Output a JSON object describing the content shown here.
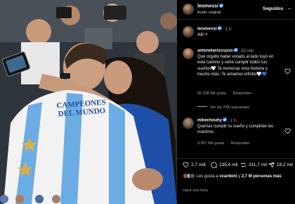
{
  "header": {
    "username": "leomessi",
    "subtitle": "Audio original",
    "follow_label": "Seguidos",
    "more_label": "···"
  },
  "caption": {
    "username": "leomessi",
    "time": "1 h",
    "text_prefix": "Allí",
    "emoji": "♥"
  },
  "comments": [
    {
      "username": "antonelaroccuzzo",
      "time": "52 min",
      "text": "Qué orgullo haber estado al lado tuyo en este camino y verte cumplir todos tus sueños🤍 Te merecías esta historia y mucho más. Te amamos infinito🤍💙",
      "likes": "92.338 Me gusta",
      "reply_label": "Responder",
      "replies_label": "Ver las 708 respuestas"
    },
    {
      "username": "mikechouhy",
      "time": "1 h",
      "text": "Querías cumplir tu sueño y cumpliste los nuestros",
      "likes": "3.567 Me gusta",
      "reply_label": "Responder"
    }
  ],
  "actions": {
    "likes": "2,7 mill.",
    "comments": "235,4 mil",
    "reposts": "311,7 mil",
    "shares": "19,2 mil"
  },
  "liked_by": {
    "prefix": "Les gusta a",
    "user": "vcardoni",
    "conjunction": "y",
    "others": "2,7 M personas más"
  },
  "timestamp": "Hace una hora",
  "photo": {
    "shirt_text_line1": "CAMPEONES",
    "shirt_text_line2": "DEL MUNDO"
  },
  "colors": {
    "verified": "#3897f0",
    "heart": "#ed4956",
    "argentina_blue": "#6cace4"
  },
  "icons": [
    "verified-icon",
    "heart-outline-icon",
    "comment-icon",
    "repost-icon",
    "share-icon"
  ]
}
